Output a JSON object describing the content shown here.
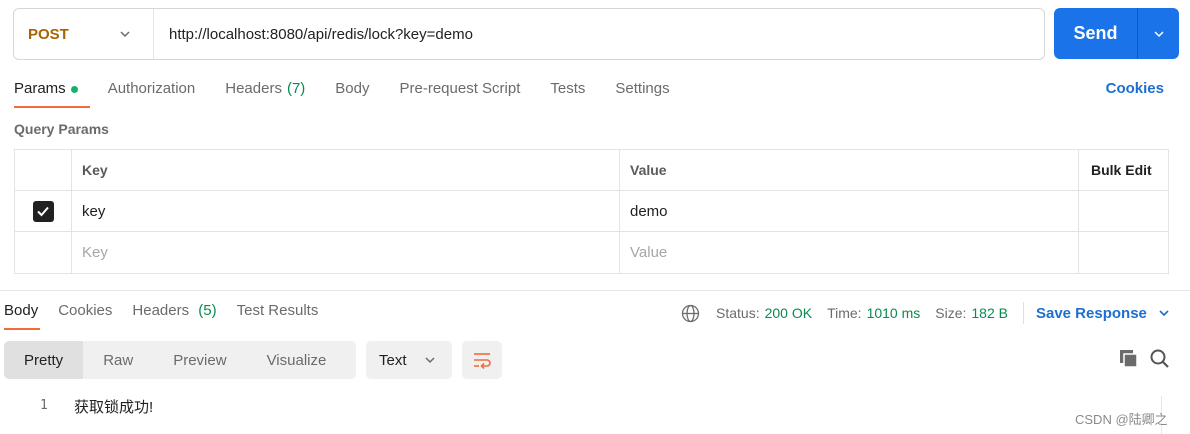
{
  "request": {
    "method": "POST",
    "url": "http://localhost:8080/api/redis/lock?key=demo",
    "send_label": "Send"
  },
  "request_tabs": [
    {
      "label": "Params",
      "badge": "",
      "active": true,
      "dot": true
    },
    {
      "label": "Authorization",
      "badge": ""
    },
    {
      "label": "Headers",
      "badge": "(7)"
    },
    {
      "label": "Body",
      "badge": ""
    },
    {
      "label": "Pre-request Script",
      "badge": ""
    },
    {
      "label": "Tests",
      "badge": ""
    },
    {
      "label": "Settings",
      "badge": ""
    }
  ],
  "cookies_label": "Cookies",
  "query_params": {
    "title": "Query Params",
    "headers": {
      "key": "Key",
      "value": "Value",
      "bulk_edit": "Bulk Edit"
    },
    "rows": [
      {
        "checked": true,
        "key": "key",
        "value": "demo"
      }
    ],
    "placeholder": {
      "key": "Key",
      "value": "Value"
    }
  },
  "response_tabs": [
    {
      "label": "Body",
      "badge": "",
      "active": true
    },
    {
      "label": "Cookies",
      "badge": ""
    },
    {
      "label": "Headers",
      "badge": "(5)"
    },
    {
      "label": "Test Results",
      "badge": ""
    }
  ],
  "response_status": {
    "status_label": "Status:",
    "status_value": "200 OK",
    "time_label": "Time:",
    "time_value": "1010 ms",
    "size_label": "Size:",
    "size_value": "182 B",
    "save_label": "Save Response"
  },
  "view_modes": [
    "Pretty",
    "Raw",
    "Preview",
    "Visualize"
  ],
  "format": "Text",
  "response_body": {
    "line_number": "1",
    "line_text": "获取锁成功!"
  },
  "watermark": "CSDN @陆卿之",
  "colors": {
    "accent_orange": "#f26b3a",
    "send_blue": "#1a73e8",
    "method_post": "#a86400",
    "success_green": "#0b8a4e"
  }
}
